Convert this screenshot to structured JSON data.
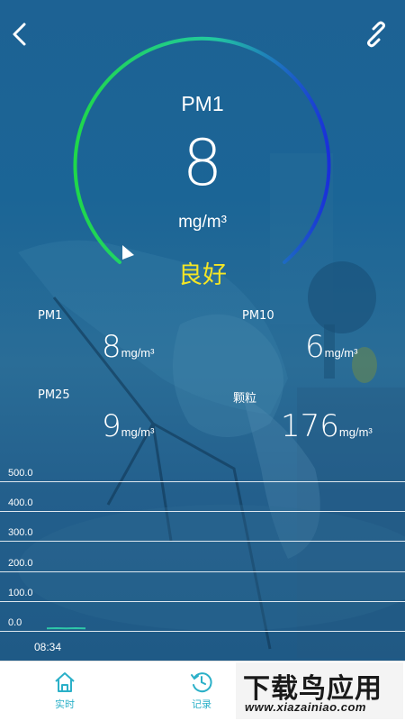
{
  "header": {
    "back_icon": "chevron-left-icon",
    "link_icon": "link-icon"
  },
  "gauge": {
    "name": "PM1",
    "value": "8",
    "unit": "mg/m³",
    "status": "良好",
    "status_color": "#f5e625",
    "arc_start_color": "#1fd84a",
    "arc_end_color": "#1a2fd9"
  },
  "metrics": [
    {
      "name": "PM1",
      "value": "8",
      "unit": "mg/m³"
    },
    {
      "name": "PM10",
      "value": "6",
      "unit": "mg/m³"
    },
    {
      "name": "PM25",
      "value": "9",
      "unit": "mg/m³"
    },
    {
      "name": "颗粒",
      "value": "176",
      "unit": "mg/m³"
    }
  ],
  "chart_data": {
    "type": "line",
    "title": "",
    "xlabel": "",
    "ylabel": "",
    "y_ticks": [
      "500.0",
      "400.0",
      "300.0",
      "200.0",
      "100.0",
      "0.0"
    ],
    "x_ticks": [
      "08:34"
    ],
    "ylim": [
      0,
      500
    ],
    "grid": true,
    "series_color": "#2ec7a8",
    "series": [
      {
        "values": [
          8,
          9,
          8,
          9,
          8
        ]
      }
    ]
  },
  "tabbar": {
    "tabs": [
      {
        "label": "实时",
        "icon": "home-icon"
      },
      {
        "label": "记录",
        "icon": "history-icon"
      }
    ],
    "accent": "#2bb0c8"
  },
  "watermark": {
    "title": "下载鸟应用",
    "url": "www.xiazainiao.com"
  }
}
